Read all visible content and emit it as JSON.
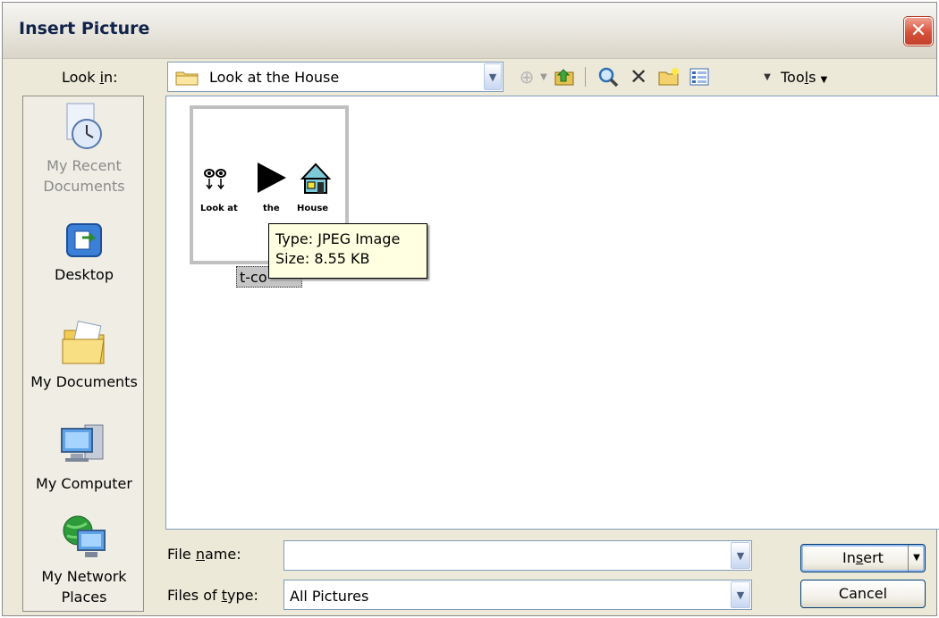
{
  "window": {
    "title": "Insert Picture",
    "close_glyph": "✕"
  },
  "look_in": {
    "label_pre": "Look ",
    "label_accel": "i",
    "label_post": "n:",
    "value": "Look at the House"
  },
  "toolbar": {
    "tools_pre": "Too",
    "tools_accel": "l",
    "tools_post": "s"
  },
  "places": [
    {
      "label": "My Recent Documents",
      "line1": "My Recent",
      "line2": "Documents",
      "icon": "recent-documents-icon"
    },
    {
      "label": "Desktop",
      "icon": "desktop-icon"
    },
    {
      "label": "My Documents",
      "icon": "my-documents-icon"
    },
    {
      "label": "My Computer",
      "icon": "my-computer-icon"
    },
    {
      "label": "My Network Places",
      "line1": "My Network",
      "line2": "Places",
      "icon": "network-places-icon"
    }
  ],
  "files": [
    {
      "name": "t-co",
      "thumb_words": [
        "Look at",
        "the",
        "House"
      ]
    }
  ],
  "tooltip": {
    "type": "Type: JPEG Image",
    "size": "Size: 8.55 KB"
  },
  "form": {
    "file_name_pre": "File ",
    "file_name_accel": "n",
    "file_name_post": "ame:",
    "file_name_value": "",
    "files_type_pre": "Files of ",
    "files_type_accel": "t",
    "files_type_post": "ype:",
    "files_type_value": "All Pictures"
  },
  "buttons": {
    "insert_pre": "In",
    "insert_accel": "s",
    "insert_post": "ert",
    "cancel": "Cancel"
  },
  "colors": {
    "title_text": "#10234a",
    "tooltip_bg": "#ffffe1",
    "dialog_bg": "#ece9d8",
    "close_red": "#d7513b"
  }
}
